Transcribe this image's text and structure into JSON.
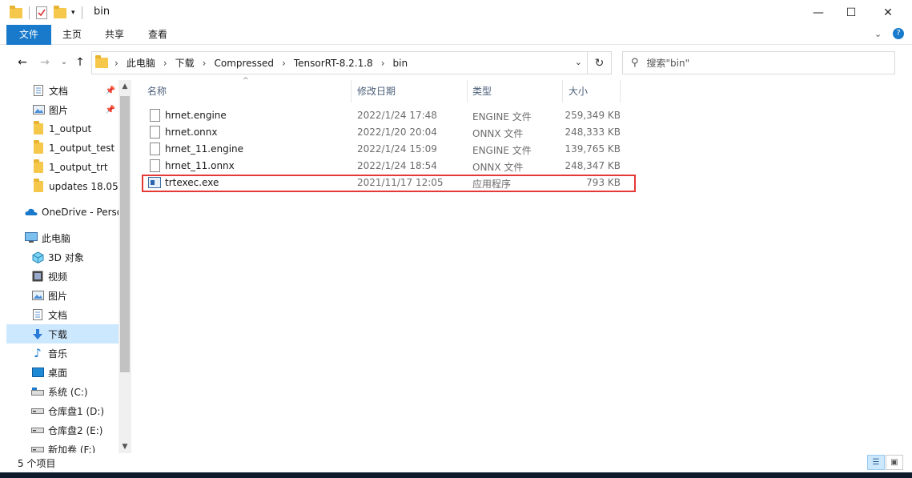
{
  "window": {
    "title": "bin",
    "minimize": "—",
    "maximize": "☐",
    "close": "✕"
  },
  "ribbon": {
    "tabs": [
      "文件",
      "主页",
      "共享",
      "查看"
    ],
    "expand": "⌄",
    "help": "?"
  },
  "address": {
    "back": "←",
    "forward": "→",
    "recent": "⌄",
    "up": "↑",
    "crumbs": [
      "此电脑",
      "下载",
      "Compressed",
      "TensorRT-8.2.1.8",
      "bin"
    ],
    "dropdown": "⌄",
    "refresh": "↻"
  },
  "search": {
    "placeholder": "搜索\"bin\"",
    "icon": "search-icon"
  },
  "nav_pane": {
    "items": [
      {
        "label": "文档",
        "icon": "documents-icon",
        "pinned": true
      },
      {
        "label": "图片",
        "icon": "pictures-icon",
        "pinned": true
      },
      {
        "label": "1_output",
        "icon": "folder-icon",
        "pinned": false
      },
      {
        "label": "1_output_test",
        "icon": "folder-icon",
        "pinned": false
      },
      {
        "label": "1_output_trt",
        "icon": "folder-icon",
        "pinned": false
      },
      {
        "label": "updates 18.05.",
        "icon": "folder-icon",
        "pinned": false
      },
      {
        "label": "OneDrive - Perso",
        "icon": "onedrive-icon",
        "pinned": false
      },
      {
        "label": "此电脑",
        "icon": "computer-icon",
        "pinned": false
      },
      {
        "label": "3D 对象",
        "icon": "3d-objects-icon",
        "pinned": false
      },
      {
        "label": "视频",
        "icon": "videos-icon",
        "pinned": false
      },
      {
        "label": "图片",
        "icon": "pictures-icon",
        "pinned": false
      },
      {
        "label": "文档",
        "icon": "documents-icon",
        "pinned": false
      },
      {
        "label": "下载",
        "icon": "downloads-icon",
        "pinned": false,
        "selected": true
      },
      {
        "label": "音乐",
        "icon": "music-icon",
        "pinned": false
      },
      {
        "label": "桌面",
        "icon": "desktop-icon",
        "pinned": false
      },
      {
        "label": "系统 (C:)",
        "icon": "system-drive-icon",
        "pinned": false
      },
      {
        "label": "仓库盘1 (D:)",
        "icon": "drive-icon",
        "pinned": false
      },
      {
        "label": "仓库盘2 (E:)",
        "icon": "drive-icon",
        "pinned": false
      },
      {
        "label": "新加卷 (F:)",
        "icon": "drive-icon",
        "pinned": false
      }
    ]
  },
  "file_list": {
    "columns": [
      "名称",
      "修改日期",
      "类型",
      "大小"
    ],
    "sort_indicator": "^",
    "rows": [
      {
        "name": "hrnet.engine",
        "date": "2022/1/24 17:48",
        "type": "ENGINE 文件",
        "size": "259,349 KB",
        "icon": "file-icon"
      },
      {
        "name": "hrnet.onnx",
        "date": "2022/1/20 20:04",
        "type": "ONNX 文件",
        "size": "248,333 KB",
        "icon": "file-icon"
      },
      {
        "name": "hrnet_11.engine",
        "date": "2022/1/24 15:09",
        "type": "ENGINE 文件",
        "size": "139,765 KB",
        "icon": "file-icon"
      },
      {
        "name": "hrnet_11.onnx",
        "date": "2022/1/24 18:54",
        "type": "ONNX 文件",
        "size": "248,347 KB",
        "icon": "file-icon"
      },
      {
        "name": "trtexec.exe",
        "date": "2021/11/17 12:05",
        "type": "应用程序",
        "size": "793 KB",
        "icon": "exe-icon",
        "highlighted": true
      }
    ]
  },
  "status_bar": {
    "count": "5 个项目"
  },
  "colors": {
    "accent": "#1979ca",
    "selection": "#cce8ff",
    "highlight_border": "#e53935"
  }
}
